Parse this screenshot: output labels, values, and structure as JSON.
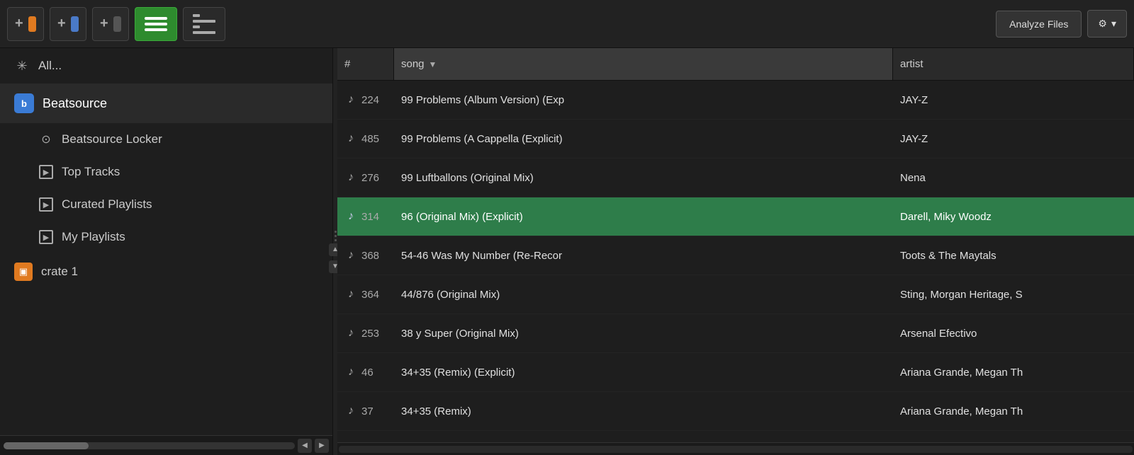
{
  "toolbar": {
    "add_crate_label": "+",
    "analyze_files_label": "Analyze Files",
    "settings_label": "⚙",
    "settings_arrow": "▾"
  },
  "sidebar": {
    "all_label": "All...",
    "beatsource_label": "Beatsource",
    "beatsource_locker_label": "Beatsource Locker",
    "top_tracks_label": "Top Tracks",
    "curated_playlists_label": "Curated Playlists",
    "my_playlists_label": "My Playlists",
    "crate1_label": "crate 1"
  },
  "table": {
    "col_num": "#",
    "col_song": "song",
    "col_artist": "artist",
    "rows": [
      {
        "num": "224",
        "song": "99 Problems (Album Version) (Exp",
        "artist": "JAY-Z",
        "selected": false
      },
      {
        "num": "485",
        "song": "99 Problems (A Cappella (Explicit)",
        "artist": "JAY-Z",
        "selected": false
      },
      {
        "num": "276",
        "song": "99 Luftballons (Original Mix)",
        "artist": "Nena",
        "selected": false
      },
      {
        "num": "314",
        "song": "96 (Original Mix) (Explicit)",
        "artist": "Darell, Miky Woodz",
        "selected": true
      },
      {
        "num": "368",
        "song": "54-46 Was My Number (Re-Recor",
        "artist": "Toots & The Maytals",
        "selected": false
      },
      {
        "num": "364",
        "song": "44/876 (Original Mix)",
        "artist": "Sting, Morgan Heritage, S",
        "selected": false
      },
      {
        "num": "253",
        "song": "38 y Super (Original Mix)",
        "artist": "Arsenal Efectivo",
        "selected": false
      },
      {
        "num": "46",
        "song": "34+35 (Remix) (Explicit)",
        "artist": "Ariana Grande, Megan Th",
        "selected": false
      },
      {
        "num": "37",
        "song": "34+35 (Remix)",
        "artist": "Ariana Grande, Megan Th",
        "selected": false
      }
    ]
  }
}
